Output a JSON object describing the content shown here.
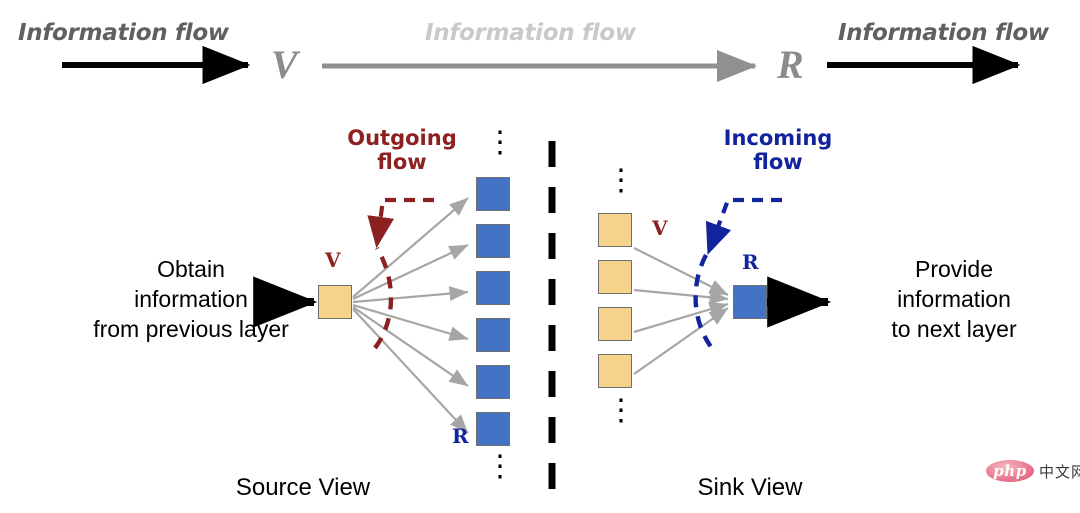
{
  "header": {
    "left_flow_label": "Information flow",
    "middle_flow_label": "Information flow",
    "right_flow_label": "Information flow",
    "node_v": "V",
    "node_r": "R",
    "colors": {
      "dark_text": "#606060",
      "light_text": "#c9c9c9",
      "dark_arrow": "#000000",
      "light_arrow": "#909090",
      "node_letter": "#8c8c8c"
    }
  },
  "source_view": {
    "caption": "Source View",
    "callout_line1": "Outgoing",
    "callout_line2": "flow",
    "callout_color": "#8d2121",
    "input_text_line1": "Obtain",
    "input_text_line2": "information",
    "input_text_line3": "from previous layer",
    "v_tag": "V",
    "r_tag": "R",
    "source_node_color": "#f6d38a",
    "target_node_color": "#4472c4",
    "target_count": 6,
    "ellipsis_top": "⋮",
    "ellipsis_bottom": "⋮"
  },
  "sink_view": {
    "caption": "Sink View",
    "callout_line1": "Incoming",
    "callout_line2": "flow",
    "callout_color": "#12239e",
    "output_text_line1": "Provide",
    "output_text_line2": "information",
    "output_text_line3": "to next layer",
    "v_tag": "V",
    "r_tag": "R",
    "source_node_color": "#f6d38a",
    "target_node_color": "#4472c4",
    "source_count": 4,
    "ellipsis_top": "⋮",
    "ellipsis_bottom": "⋮"
  },
  "divider": {
    "style": "vertical-dashed",
    "color": "#000000"
  },
  "watermark": {
    "logo_text": "php",
    "site_text": "中文网"
  }
}
